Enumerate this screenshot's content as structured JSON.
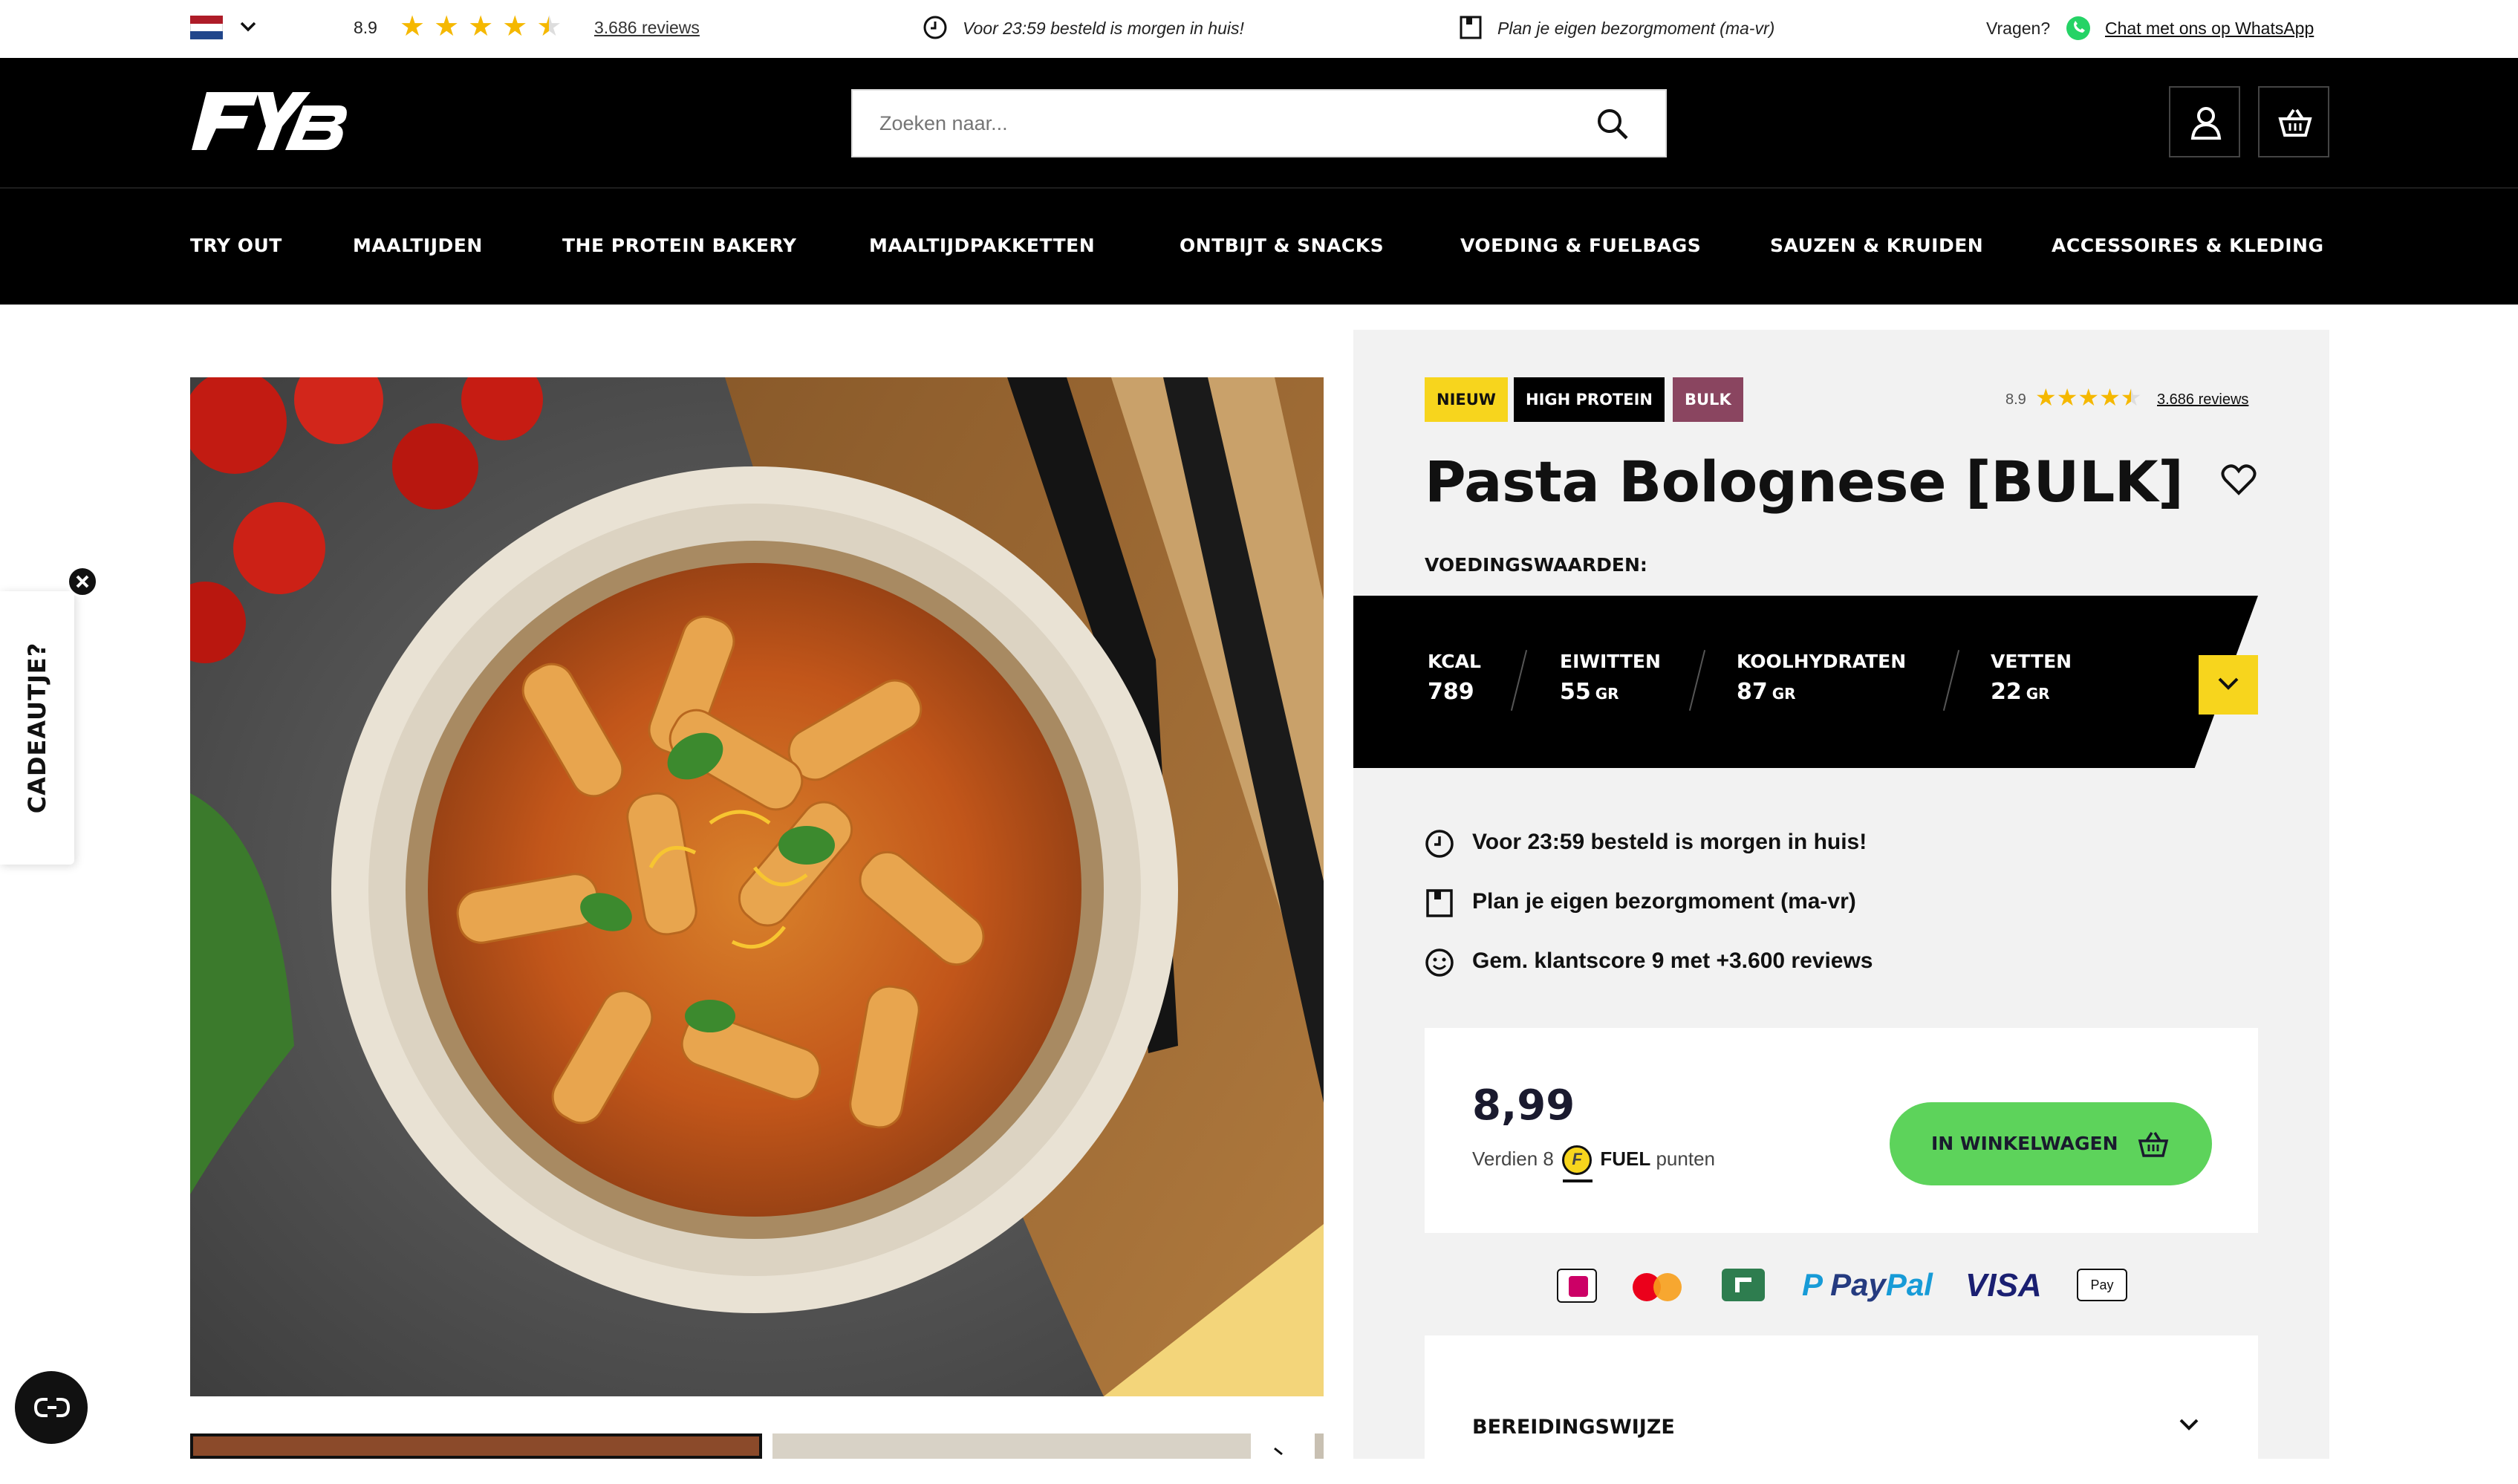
{
  "topbar": {
    "language_flag": "netherlands-flag-icon",
    "rating": "8.9",
    "stars": 4.5,
    "reviews_link": "3.686 reviews",
    "delivery_text": "Voor 23:59 besteld is morgen in huis!",
    "plan_text": "Plan je eigen bezorgmoment (ma-vr)",
    "questions_label": "Vragen?",
    "whatsapp_link": "Chat met ons op WhatsApp"
  },
  "header": {
    "logo": "FYB",
    "search_placeholder": "Zoeken naar..."
  },
  "nav": {
    "items": [
      {
        "label": "TRY OUT"
      },
      {
        "label": "MAALTIJDEN"
      },
      {
        "label": "THE PROTEIN BAKERY"
      },
      {
        "label": "MAALTIJDPAKKETTEN"
      },
      {
        "label": "ONTBIJT & SNACKS"
      },
      {
        "label": "VOEDING & FUELBAGS"
      },
      {
        "label": "SAUZEN & KRUIDEN"
      },
      {
        "label": "ACCESSOIRES & KLEDING"
      }
    ]
  },
  "side_tab": {
    "label": "CADEAUTJE?"
  },
  "product": {
    "badges": [
      "NIEUW",
      "HIGH PROTEIN",
      "BULK"
    ],
    "rating": "8.9",
    "reviews_link": "3.686 reviews",
    "title": "Pasta Bolognese [BULK]",
    "nutrition_heading": "VOEDINGSWAARDEN:",
    "nutrition": [
      {
        "label": "KCAL",
        "value": "789",
        "unit": ""
      },
      {
        "label": "EIWITTEN",
        "value": "55",
        "unit": "GR"
      },
      {
        "label": "KOOLHYDRATEN",
        "value": "87",
        "unit": "GR"
      },
      {
        "label": "VETTEN",
        "value": "22",
        "unit": "GR"
      }
    ],
    "usps": [
      "Voor 23:59 besteld is morgen in huis!",
      "Plan je eigen bezorgmoment (ma-vr)",
      "Gem. klantscore 9 met +3.600 reviews"
    ],
    "price": "8,99",
    "points_prefix": "Verdien 8",
    "points_brand": "FUEL",
    "points_suffix": "punten",
    "add_to_cart": "IN WINKELWAGEN",
    "payment_methods": [
      "iDEAL",
      "Mastercard",
      "Riverty",
      "PayPal",
      "VISA",
      "Apple Pay"
    ],
    "accordion_label": "BEREIDINGSWIJZE"
  },
  "colors": {
    "accent_yellow": "#f7d51d",
    "cart_green": "#5dd35b",
    "bulk_badge": "#8a4560",
    "panel_bg": "#f2f2f2"
  }
}
